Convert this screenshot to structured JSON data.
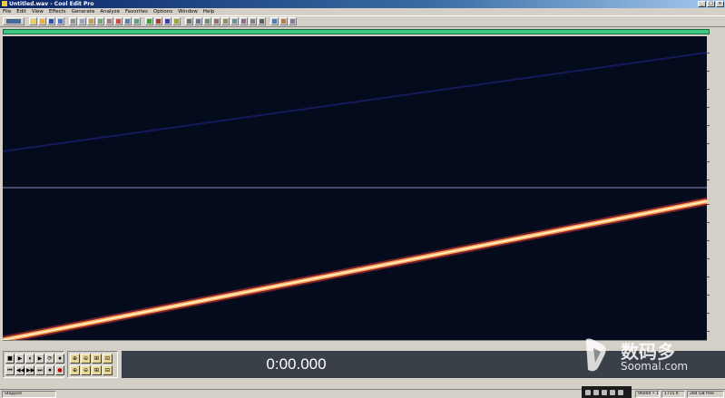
{
  "window": {
    "title": "Untitled.wav - Cool Edit Pro"
  },
  "menu": {
    "items": [
      "File",
      "Edit",
      "View",
      "Effects",
      "Generate",
      "Analyze",
      "Favorites",
      "Options",
      "Window",
      "Help"
    ]
  },
  "transport": {
    "row1": [
      "■",
      "▶",
      "⏸",
      "▶",
      "⟳",
      "⏺"
    ],
    "row2": [
      "⏮",
      "◀◀",
      "▶▶",
      "⏭",
      "⏺",
      "●"
    ]
  },
  "zoom": {
    "buttons": [
      "⊕",
      "⊖",
      "⊞",
      "⊟",
      "⊕",
      "⊖",
      "⊞",
      "⊟"
    ]
  },
  "time_display": {
    "value": "0:00.000"
  },
  "status": {
    "state": "Stopped",
    "format": "Stereo",
    "size": "1715 K",
    "free": "284 GB free",
    "bits": "96000 • 16-bit"
  },
  "watermark": {
    "name": "数码多",
    "url": "Soomal.com"
  },
  "colors": {
    "overview": "#3cc882",
    "spectrogram_bg": "#040b1c",
    "sweep": "#ffe6a0"
  }
}
